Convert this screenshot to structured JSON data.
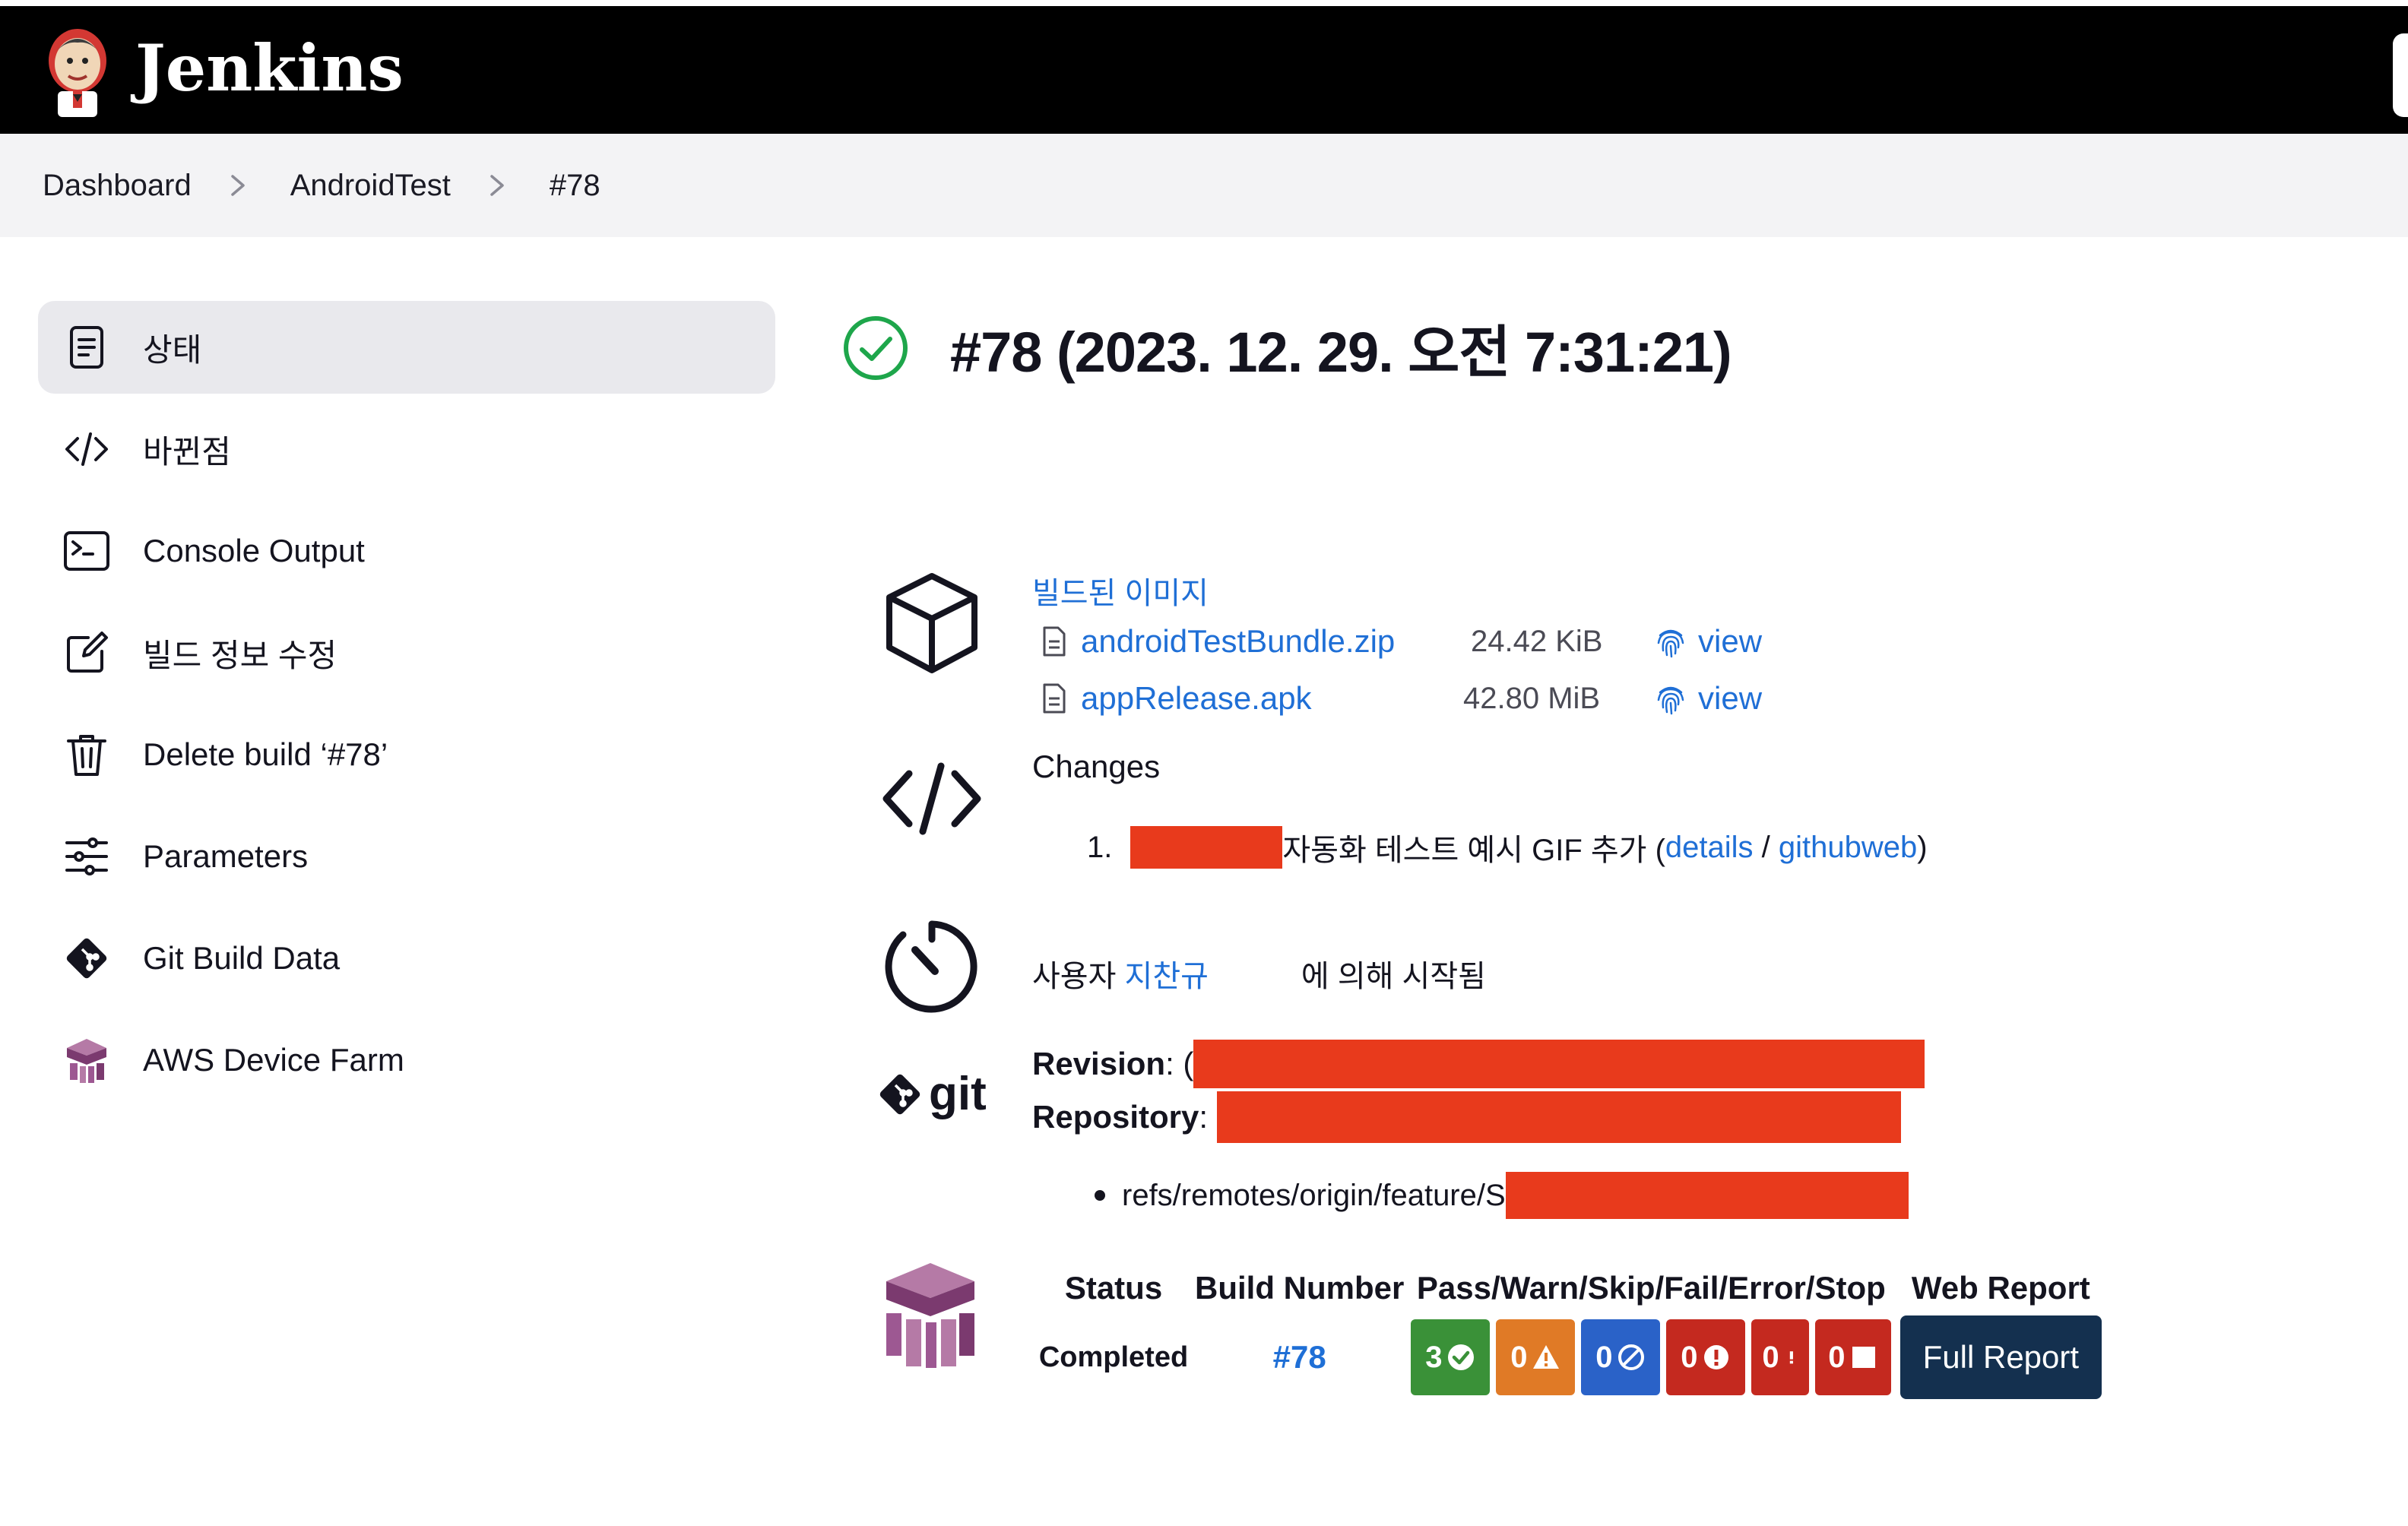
{
  "header": {
    "brand": "Jenkins"
  },
  "breadcrumbs": [
    "Dashboard",
    "AndroidTest",
    "#78"
  ],
  "sidebar": {
    "items": [
      {
        "label": "상태",
        "icon": "status-icon",
        "active": true
      },
      {
        "label": "바뀐점",
        "icon": "code-icon"
      },
      {
        "label": "Console Output",
        "icon": "terminal-icon"
      },
      {
        "label": "빌드 정보 수정",
        "icon": "edit-icon"
      },
      {
        "label": "Delete build ‘#78’",
        "icon": "trash-icon"
      },
      {
        "label": "Parameters",
        "icon": "sliders-icon"
      },
      {
        "label": "Git Build Data",
        "icon": "git-icon"
      },
      {
        "label": "AWS Device Farm",
        "icon": "aws-device-farm-icon"
      }
    ]
  },
  "build": {
    "title": "#78 (2023. 12. 29. 오전 7:31:21)",
    "status_icon": "success-check-icon",
    "status_color": "#1ea64b"
  },
  "artifacts": {
    "title": "빌드된 이미지",
    "files": [
      {
        "name": "androidTestBundle.zip",
        "size": "24.42 KiB",
        "view": "view"
      },
      {
        "name": "appRelease.apk",
        "size": "42.80 MiB",
        "view": "view"
      }
    ]
  },
  "changes": {
    "title": "Changes",
    "items": [
      {
        "number": "1.",
        "text": "자동화 테스트 예시 GIF 추가 (",
        "details": "details",
        "slash": " / ",
        "githubweb": "githubweb",
        "close": ")"
      }
    ]
  },
  "started_by": {
    "prefix": "사용자 ",
    "user": "지찬규",
    "suffix": "에 의해 시작됨"
  },
  "git": {
    "logo_text": "git",
    "revision_label": "Revision",
    "revision_visible": "(",
    "repository_label": "Repository",
    "branch_visible": "refs/remotes/origin/feature/S"
  },
  "device_farm": {
    "headers": [
      "Status",
      "Build Number",
      "Pass/Warn/Skip/Fail/Error/Stop",
      "Web Report"
    ],
    "row": {
      "status": "Completed",
      "build_number": "#78",
      "badges": [
        {
          "count": "3",
          "kind": "pass",
          "color": "#3a9138"
        },
        {
          "count": "0",
          "kind": "warn",
          "color": "#e07a26"
        },
        {
          "count": "0",
          "kind": "skip",
          "color": "#2a62c8"
        },
        {
          "count": "0",
          "kind": "fail",
          "color": "#c4291f"
        },
        {
          "count": "0",
          "kind": "error",
          "color": "#c4291f"
        },
        {
          "count": "0",
          "kind": "stop",
          "color": "#c4291f"
        }
      ],
      "web_report": "Full Report"
    }
  },
  "colors": {
    "link": "#1f6fd6",
    "redaction": "#e83a1c",
    "report_button": "#14304f"
  }
}
